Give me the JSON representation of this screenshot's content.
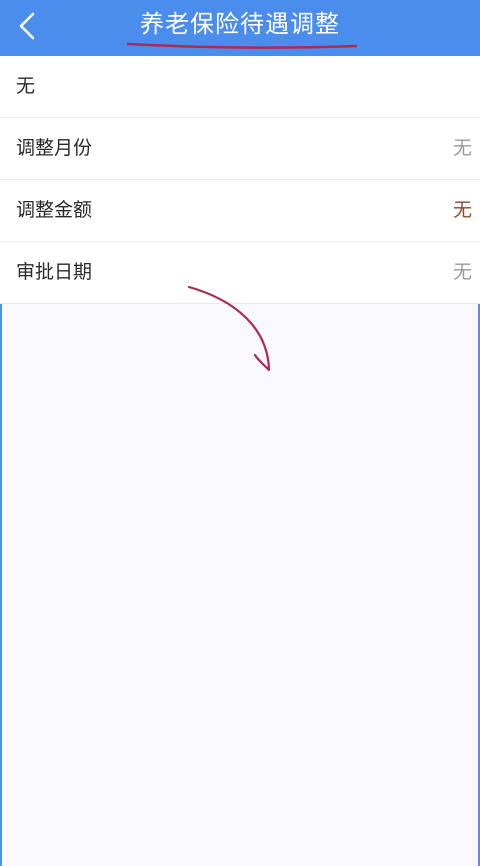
{
  "header": {
    "title": "养老保险待遇调整",
    "back_icon": "chevron-left-icon"
  },
  "list": {
    "first_row": "无",
    "rows": [
      {
        "label": "调整月份",
        "value": "无"
      },
      {
        "label": "调整金额",
        "value": "无"
      },
      {
        "label": "审批日期",
        "value": "无"
      }
    ]
  },
  "colors": {
    "header_bg": "#4a8dec",
    "annotation": "#b0294f",
    "accent_value": "#8a4a2a"
  }
}
